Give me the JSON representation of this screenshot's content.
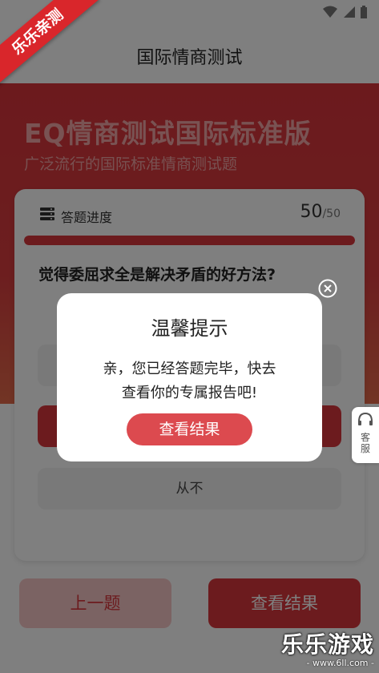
{
  "ribbon": {
    "text": "乐乐亲测"
  },
  "app_bar": {
    "title": "国际情商测试"
  },
  "hero": {
    "title": "EQ情商测试国际标准版",
    "subtitle": "广泛流行的国际标准情商测试题"
  },
  "card": {
    "progress_label": "答题进度",
    "progress_current": "50",
    "progress_total": "/50",
    "progress_fraction": 1.0,
    "question": "觉得委屈求全是解决矛盾的好方法?",
    "options": [
      {
        "label": ""
      },
      {
        "label": ""
      },
      {
        "label": "从不"
      }
    ]
  },
  "buttons": {
    "prev": "上一题",
    "result": "查看结果"
  },
  "side_service": {
    "line1": "客",
    "line2": "服"
  },
  "dialog": {
    "title": "温馨提示",
    "message_line1": "亲，您已经答题完毕，快去",
    "message_line2": "查看你的专属报告吧!",
    "button": "查看结果"
  },
  "watermark": {
    "main": "乐乐游戏",
    "url": "- www.6ll.com -"
  },
  "colors": {
    "accent": "#d9373d",
    "hero": "#d8343b"
  }
}
